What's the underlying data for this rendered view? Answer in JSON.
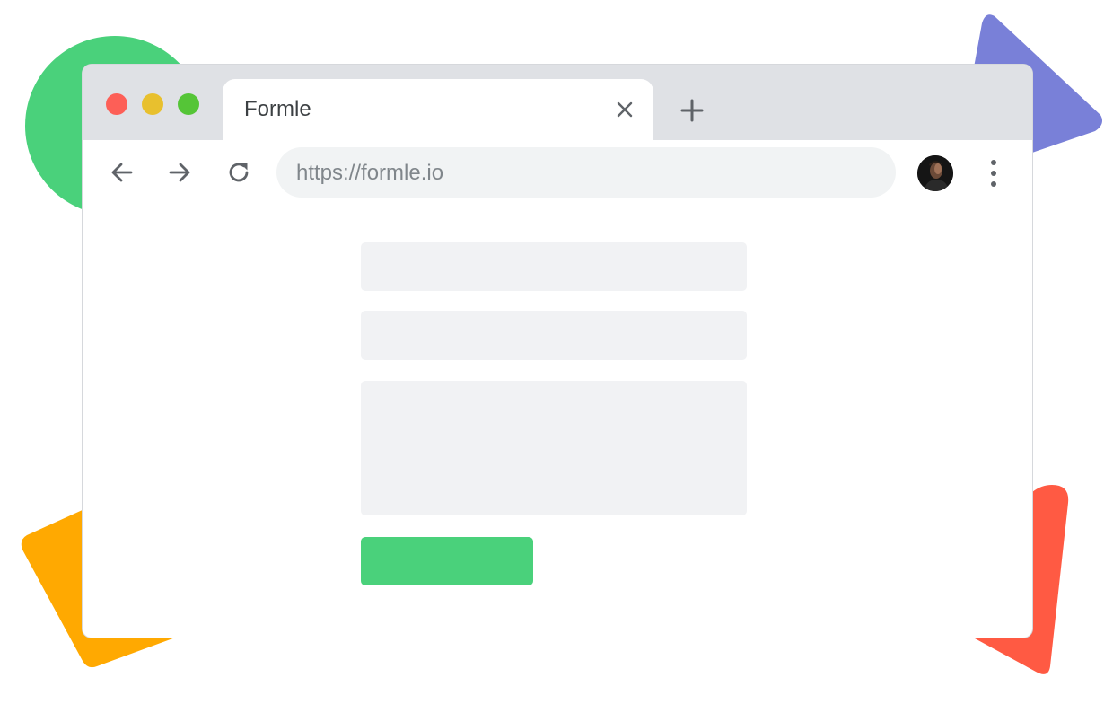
{
  "browser": {
    "tab": {
      "title": "Formle"
    },
    "address_bar": {
      "url": "https://formle.io"
    }
  },
  "colors": {
    "traffic_red": "#fd5f57",
    "traffic_yellow": "#e8c02e",
    "traffic_green": "#55c537",
    "form_field": "#f1f2f4",
    "submit_button": "#4ad17b",
    "deco_green": "#4ad17b",
    "deco_purple": "#7980d8",
    "deco_orange": "#ffa901",
    "deco_red": "#ff5a43"
  },
  "icons": {
    "back": "arrow-left-icon",
    "forward": "arrow-right-icon",
    "reload": "reload-icon",
    "close_tab": "close-icon",
    "new_tab": "plus-icon",
    "menu": "more-vert-icon"
  },
  "form": {
    "fields": [
      "text-field",
      "text-field",
      "textarea"
    ],
    "submit_label": ""
  }
}
